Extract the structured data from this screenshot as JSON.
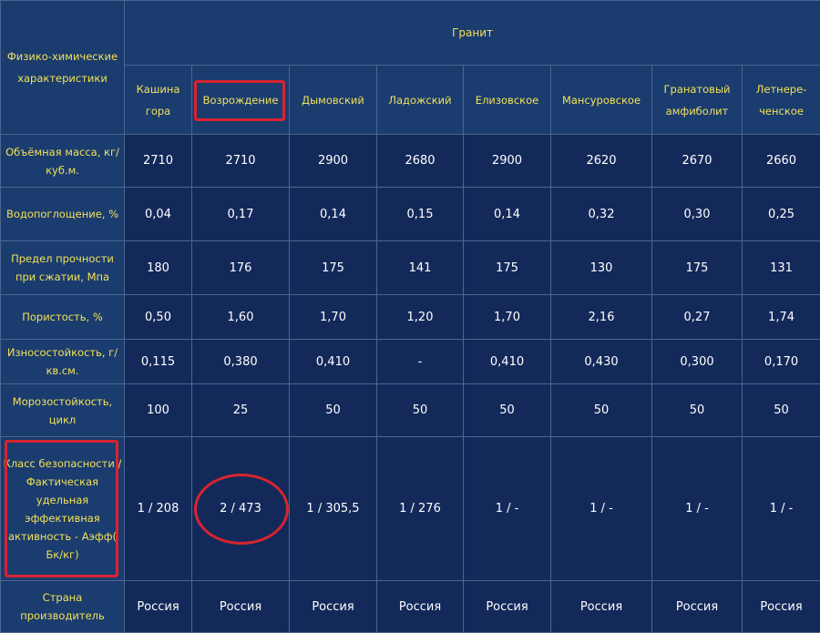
{
  "header": {
    "param_title": "Физико-химические характеристики",
    "group_title": "Гранит",
    "columns": [
      "Кашина гора",
      "Возрождение",
      "Дымовский",
      "Ладожский",
      "Елизовское",
      "Мансуровское",
      "Гранатовый амфиболит",
      "Летнере-ченское"
    ]
  },
  "rows": [
    {
      "label": "Объёмная масса, кг/куб.м.",
      "values": [
        "2710",
        "2710",
        "2900",
        "2680",
        "2900",
        "2620",
        "2670",
        "2660"
      ]
    },
    {
      "label": "Водопоглощение, %",
      "values": [
        "0,04",
        "0,17",
        "0,14",
        "0,15",
        "0,14",
        "0,32",
        "0,30",
        "0,25"
      ]
    },
    {
      "label": "Предел прочности при сжатии, Мпа",
      "values": [
        "180",
        "176",
        "175",
        "141",
        "175",
        "130",
        "175",
        "131"
      ]
    },
    {
      "label": "Пористость, %",
      "values": [
        "0,50",
        "1,60",
        "1,70",
        "1,20",
        "1,70",
        "2,16",
        "0,27",
        "1,74"
      ]
    },
    {
      "label": "Износостойкость, г/кв.см.",
      "values": [
        "0,115",
        "0,380",
        "0,410",
        "-",
        "0,410",
        "0,430",
        "0,300",
        "0,170"
      ]
    },
    {
      "label": "Морозостойкость, цикл",
      "values": [
        "100",
        "25",
        "50",
        "50",
        "50",
        "50",
        "50",
        "50"
      ]
    },
    {
      "label": "Класс безопасности / Фактическая удельная эффективная активность - Аэфф( Бк/кг)",
      "values": [
        "1 / 208",
        "2 / 473",
        "1 / 305,5",
        "1 / 276",
        "1 / -",
        "1 / -",
        "1 / -",
        "1 / -"
      ]
    },
    {
      "label": "Страна производитель",
      "values": [
        "Россия",
        "Россия",
        "Россия",
        "Россия",
        "Россия",
        "Россия",
        "Россия",
        "Россия"
      ]
    }
  ],
  "highlight_color": "#d7242f"
}
